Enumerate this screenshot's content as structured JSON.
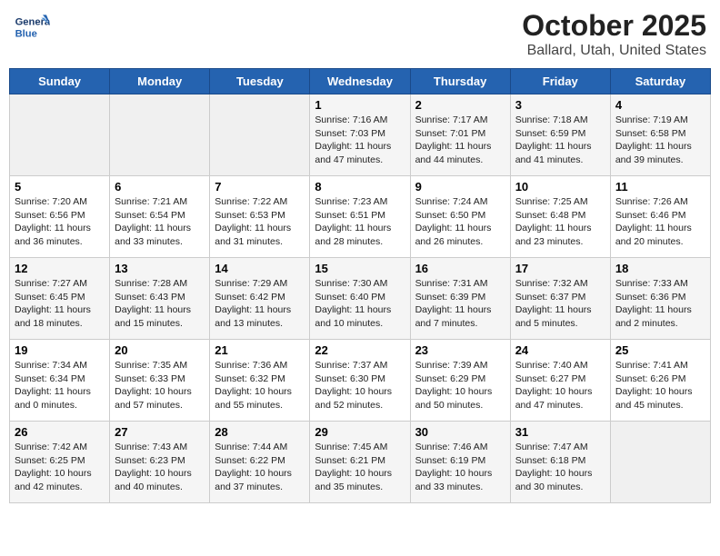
{
  "header": {
    "logo_text_general": "General",
    "logo_text_blue": "Blue",
    "title": "October 2025",
    "subtitle": "Ballard, Utah, United States"
  },
  "days_of_week": [
    "Sunday",
    "Monday",
    "Tuesday",
    "Wednesday",
    "Thursday",
    "Friday",
    "Saturday"
  ],
  "weeks": [
    [
      {
        "day": "",
        "info": ""
      },
      {
        "day": "",
        "info": ""
      },
      {
        "day": "",
        "info": ""
      },
      {
        "day": "1",
        "info": "Sunrise: 7:16 AM\nSunset: 7:03 PM\nDaylight: 11 hours and 47 minutes."
      },
      {
        "day": "2",
        "info": "Sunrise: 7:17 AM\nSunset: 7:01 PM\nDaylight: 11 hours and 44 minutes."
      },
      {
        "day": "3",
        "info": "Sunrise: 7:18 AM\nSunset: 6:59 PM\nDaylight: 11 hours and 41 minutes."
      },
      {
        "day": "4",
        "info": "Sunrise: 7:19 AM\nSunset: 6:58 PM\nDaylight: 11 hours and 39 minutes."
      }
    ],
    [
      {
        "day": "5",
        "info": "Sunrise: 7:20 AM\nSunset: 6:56 PM\nDaylight: 11 hours and 36 minutes."
      },
      {
        "day": "6",
        "info": "Sunrise: 7:21 AM\nSunset: 6:54 PM\nDaylight: 11 hours and 33 minutes."
      },
      {
        "day": "7",
        "info": "Sunrise: 7:22 AM\nSunset: 6:53 PM\nDaylight: 11 hours and 31 minutes."
      },
      {
        "day": "8",
        "info": "Sunrise: 7:23 AM\nSunset: 6:51 PM\nDaylight: 11 hours and 28 minutes."
      },
      {
        "day": "9",
        "info": "Sunrise: 7:24 AM\nSunset: 6:50 PM\nDaylight: 11 hours and 26 minutes."
      },
      {
        "day": "10",
        "info": "Sunrise: 7:25 AM\nSunset: 6:48 PM\nDaylight: 11 hours and 23 minutes."
      },
      {
        "day": "11",
        "info": "Sunrise: 7:26 AM\nSunset: 6:46 PM\nDaylight: 11 hours and 20 minutes."
      }
    ],
    [
      {
        "day": "12",
        "info": "Sunrise: 7:27 AM\nSunset: 6:45 PM\nDaylight: 11 hours and 18 minutes."
      },
      {
        "day": "13",
        "info": "Sunrise: 7:28 AM\nSunset: 6:43 PM\nDaylight: 11 hours and 15 minutes."
      },
      {
        "day": "14",
        "info": "Sunrise: 7:29 AM\nSunset: 6:42 PM\nDaylight: 11 hours and 13 minutes."
      },
      {
        "day": "15",
        "info": "Sunrise: 7:30 AM\nSunset: 6:40 PM\nDaylight: 11 hours and 10 minutes."
      },
      {
        "day": "16",
        "info": "Sunrise: 7:31 AM\nSunset: 6:39 PM\nDaylight: 11 hours and 7 minutes."
      },
      {
        "day": "17",
        "info": "Sunrise: 7:32 AM\nSunset: 6:37 PM\nDaylight: 11 hours and 5 minutes."
      },
      {
        "day": "18",
        "info": "Sunrise: 7:33 AM\nSunset: 6:36 PM\nDaylight: 11 hours and 2 minutes."
      }
    ],
    [
      {
        "day": "19",
        "info": "Sunrise: 7:34 AM\nSunset: 6:34 PM\nDaylight: 11 hours and 0 minutes."
      },
      {
        "day": "20",
        "info": "Sunrise: 7:35 AM\nSunset: 6:33 PM\nDaylight: 10 hours and 57 minutes."
      },
      {
        "day": "21",
        "info": "Sunrise: 7:36 AM\nSunset: 6:32 PM\nDaylight: 10 hours and 55 minutes."
      },
      {
        "day": "22",
        "info": "Sunrise: 7:37 AM\nSunset: 6:30 PM\nDaylight: 10 hours and 52 minutes."
      },
      {
        "day": "23",
        "info": "Sunrise: 7:39 AM\nSunset: 6:29 PM\nDaylight: 10 hours and 50 minutes."
      },
      {
        "day": "24",
        "info": "Sunrise: 7:40 AM\nSunset: 6:27 PM\nDaylight: 10 hours and 47 minutes."
      },
      {
        "day": "25",
        "info": "Sunrise: 7:41 AM\nSunset: 6:26 PM\nDaylight: 10 hours and 45 minutes."
      }
    ],
    [
      {
        "day": "26",
        "info": "Sunrise: 7:42 AM\nSunset: 6:25 PM\nDaylight: 10 hours and 42 minutes."
      },
      {
        "day": "27",
        "info": "Sunrise: 7:43 AM\nSunset: 6:23 PM\nDaylight: 10 hours and 40 minutes."
      },
      {
        "day": "28",
        "info": "Sunrise: 7:44 AM\nSunset: 6:22 PM\nDaylight: 10 hours and 37 minutes."
      },
      {
        "day": "29",
        "info": "Sunrise: 7:45 AM\nSunset: 6:21 PM\nDaylight: 10 hours and 35 minutes."
      },
      {
        "day": "30",
        "info": "Sunrise: 7:46 AM\nSunset: 6:19 PM\nDaylight: 10 hours and 33 minutes."
      },
      {
        "day": "31",
        "info": "Sunrise: 7:47 AM\nSunset: 6:18 PM\nDaylight: 10 hours and 30 minutes."
      },
      {
        "day": "",
        "info": ""
      }
    ]
  ]
}
